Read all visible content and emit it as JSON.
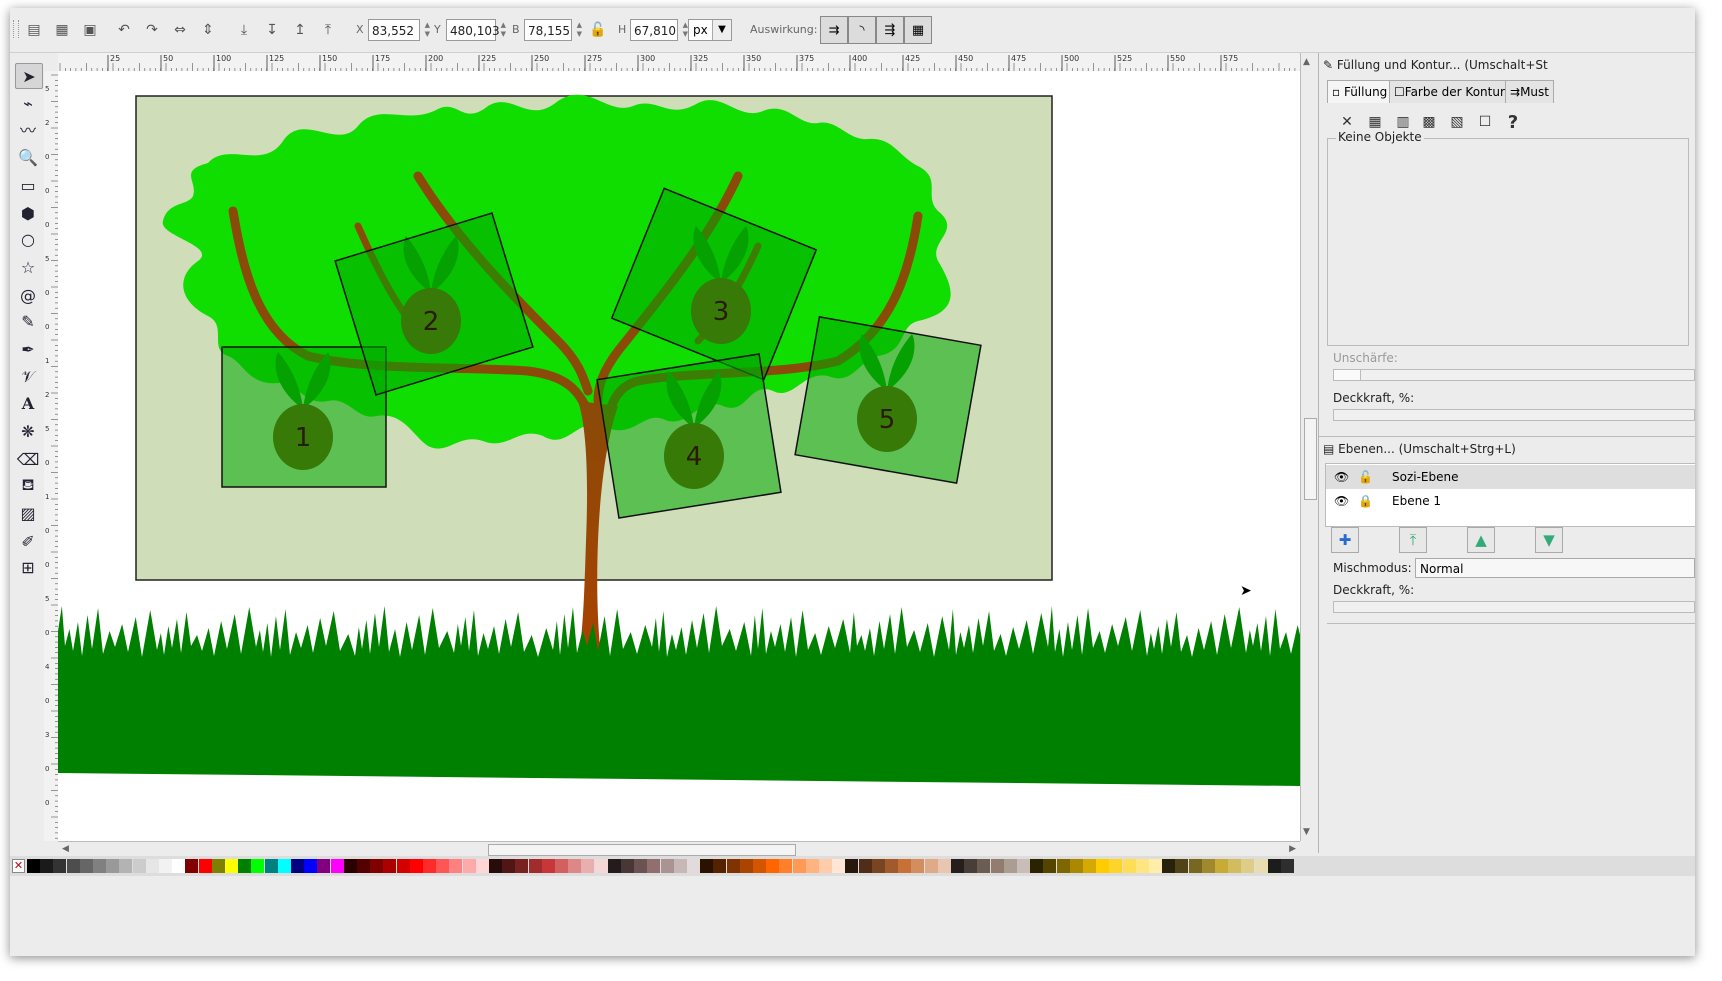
{
  "toolbar": {
    "x_label": "X",
    "x_value": "83,552",
    "y_label": "Y",
    "y_value": "480,103",
    "w_label": "B",
    "w_value": "78,155",
    "h_label": "H",
    "h_value": "67,810",
    "unit": "px",
    "affect_label": "Auswirkung:"
  },
  "ruler": {
    "h_ticks": [
      "25",
      "50",
      "100",
      "125",
      "150",
      "175",
      "200",
      "225",
      "250",
      "275",
      "300",
      "325",
      "350",
      "375",
      "400",
      "425",
      "450",
      "475",
      "500",
      "525",
      "550",
      "575"
    ],
    "v_ticks": [
      "5",
      "2",
      "0",
      "0",
      "0",
      "5",
      "0",
      "0",
      "1",
      "2",
      "5",
      "0",
      "1",
      "0",
      "0",
      "5",
      "0",
      "4",
      "0",
      "3",
      "0",
      "0"
    ]
  },
  "drawing": {
    "frame_numbers": [
      "1",
      "2",
      "3",
      "4",
      "5"
    ],
    "colors": {
      "background": "#cfddb8",
      "foliage": "#10dd00",
      "trunk": "#8a4a08",
      "grass": "#008000",
      "frame": "#00a800",
      "fruit": "#7a4410"
    }
  },
  "fill_stroke": {
    "title": "Füllung und Kontur... (Umschalt+St",
    "tabs": [
      "Füllung",
      "Farbe der Kontur",
      "Must"
    ],
    "no_objects": "Keine Objekte",
    "blur_label": "Unschärfe:",
    "opacity_label": "Deckkraft, %:"
  },
  "layers": {
    "title": "Ebenen... (Umschalt+Strg+L)",
    "items": [
      {
        "name": "Sozi-Ebene"
      },
      {
        "name": "Ebene 1"
      }
    ],
    "blend_label": "Mischmodus:",
    "blend_value": "Normal",
    "opacity_label": "Deckkraft, %:"
  },
  "palette": [
    "#000000",
    "#1a1a1a",
    "#333333",
    "#4d4d4d",
    "#666666",
    "#808080",
    "#999999",
    "#b3b3b3",
    "#cccccc",
    "#e6e6e6",
    "#f2f2f2",
    "#ffffff",
    "#800000",
    "#ff0000",
    "#808000",
    "#ffff00",
    "#008000",
    "#00ff00",
    "#008080",
    "#00ffff",
    "#000080",
    "#0000ff",
    "#800080",
    "#ff00ff",
    "#2b0000",
    "#550000",
    "#800000",
    "#aa0000",
    "#d40000",
    "#ff0000",
    "#ff2a2a",
    "#ff5555",
    "#ff8080",
    "#ffaaaa",
    "#ffd5d5",
    "#280b0b",
    "#501616",
    "#782121",
    "#a02c2c",
    "#c83737",
    "#d35f5f",
    "#de8787",
    "#e9afaf",
    "#f4d7d7",
    "#241c1c",
    "#483737",
    "#6c5353",
    "#916f6f",
    "#ac9393",
    "#c8b7b7",
    "#e3dbdb",
    "#2b1100",
    "#552200",
    "#803300",
    "#aa4400",
    "#d45500",
    "#ff6600",
    "#ff7f2a",
    "#ff9955",
    "#ffb380",
    "#ffccaa",
    "#ffe6d5",
    "#28170b",
    "#502d16",
    "#784421",
    "#a05a2c",
    "#c87137",
    "#d38d5f",
    "#deaa87",
    "#e9c6af",
    "#241f1c",
    "#483e37",
    "#6c5d53",
    "#917c6f",
    "#ac9d93",
    "#c8beb7",
    "#2b2200",
    "#554400",
    "#806600",
    "#aa8800",
    "#d4aa00",
    "#ffcc00",
    "#ffd42a",
    "#ffdd55",
    "#ffe680",
    "#ffeeaa",
    "#28220b",
    "#504416",
    "#786721",
    "#a0892c",
    "#c8ab37",
    "#d3bc5f",
    "#decd87",
    "#e9ddaf",
    "#1c1c1c",
    "#2e2e2e"
  ]
}
